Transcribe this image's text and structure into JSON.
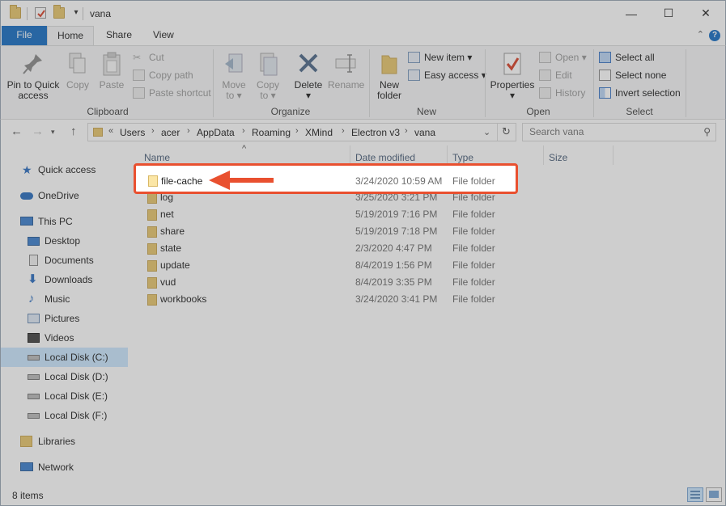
{
  "window": {
    "title": "vana",
    "minimize_glyph": "—",
    "maximize_glyph": "☐",
    "close_glyph": "✕"
  },
  "tabs": {
    "file": "File",
    "home": "Home",
    "share": "Share",
    "view": "View"
  },
  "ribbon": {
    "clipboard": {
      "group_label": "Clipboard",
      "pin_label_1": "Pin to Quick",
      "pin_label_2": "access",
      "copy_label": "Copy",
      "paste_label": "Paste",
      "cut_label": "Cut",
      "copy_path_label": "Copy path",
      "paste_shortcut_label": "Paste shortcut"
    },
    "organize": {
      "group_label": "Organize",
      "move_to_1": "Move",
      "move_to_2": "to ▾",
      "copy_to_1": "Copy",
      "copy_to_2": "to ▾",
      "delete_1": "Delete",
      "delete_2": "▾",
      "rename_label": "Rename"
    },
    "new": {
      "group_label": "New",
      "new_folder_1": "New",
      "new_folder_2": "folder",
      "new_item_label": "New item ▾",
      "easy_access_label": "Easy access ▾"
    },
    "open": {
      "group_label": "Open",
      "properties_1": "Properties",
      "properties_2": "▾",
      "open_label": "Open ▾",
      "edit_label": "Edit",
      "history_label": "History"
    },
    "select": {
      "group_label": "Select",
      "select_all_label": "Select all",
      "select_none_label": "Select none",
      "invert_selection_label": "Invert selection"
    }
  },
  "address": {
    "overflow": "«",
    "crumbs": [
      "Users",
      "acer",
      "AppData",
      "Roaming",
      "XMind",
      "Electron v3",
      "vana"
    ],
    "search_placeholder": "Search vana"
  },
  "nav_pane": {
    "items": [
      {
        "label": "Quick access",
        "icon": "star-icon"
      },
      {
        "label": "OneDrive",
        "icon": "cloud-icon"
      },
      {
        "label": "This PC",
        "icon": "pc-icon"
      },
      {
        "label": "Desktop",
        "icon": "desktop-icon"
      },
      {
        "label": "Documents",
        "icon": "documents-icon"
      },
      {
        "label": "Downloads",
        "icon": "download-icon"
      },
      {
        "label": "Music",
        "icon": "music-icon"
      },
      {
        "label": "Pictures",
        "icon": "pictures-icon"
      },
      {
        "label": "Videos",
        "icon": "videos-icon"
      },
      {
        "label": "Local Disk (C:)",
        "icon": "drive-c-icon"
      },
      {
        "label": "Local Disk (D:)",
        "icon": "drive-icon"
      },
      {
        "label": "Local Disk (E:)",
        "icon": "drive-icon"
      },
      {
        "label": "Local Disk (F:)",
        "icon": "drive-icon"
      },
      {
        "label": "Libraries",
        "icon": "libraries-icon"
      },
      {
        "label": "Network",
        "icon": "network-icon"
      }
    ],
    "selected": "Local Disk (C:)"
  },
  "file_list": {
    "columns": {
      "name": "Name",
      "date_modified": "Date modified",
      "type": "Type",
      "size": "Size"
    },
    "sort_indicator": "^",
    "rows": [
      {
        "name": "file-cache",
        "date": "3/24/2020 10:59 AM",
        "type": "File folder"
      },
      {
        "name": "log",
        "date": "3/25/2020 3:21 PM",
        "type": "File folder"
      },
      {
        "name": "net",
        "date": "5/19/2019 7:16 PM",
        "type": "File folder"
      },
      {
        "name": "share",
        "date": "5/19/2019 7:18 PM",
        "type": "File folder"
      },
      {
        "name": "state",
        "date": "2/3/2020 4:47 PM",
        "type": "File folder"
      },
      {
        "name": "update",
        "date": "8/4/2019 1:56 PM",
        "type": "File folder"
      },
      {
        "name": "vud",
        "date": "8/4/2019 3:35 PM",
        "type": "File folder"
      },
      {
        "name": "workbooks",
        "date": "3/24/2020 3:41 PM",
        "type": "File folder"
      }
    ],
    "highlighted_row": "file-cache"
  },
  "status": {
    "item_count": "8 items"
  },
  "colors": {
    "accent": "#1a6fc4",
    "highlight_border": "#e9502f",
    "folder": "#e8c66e",
    "selected_bg": "#cce8ff"
  }
}
